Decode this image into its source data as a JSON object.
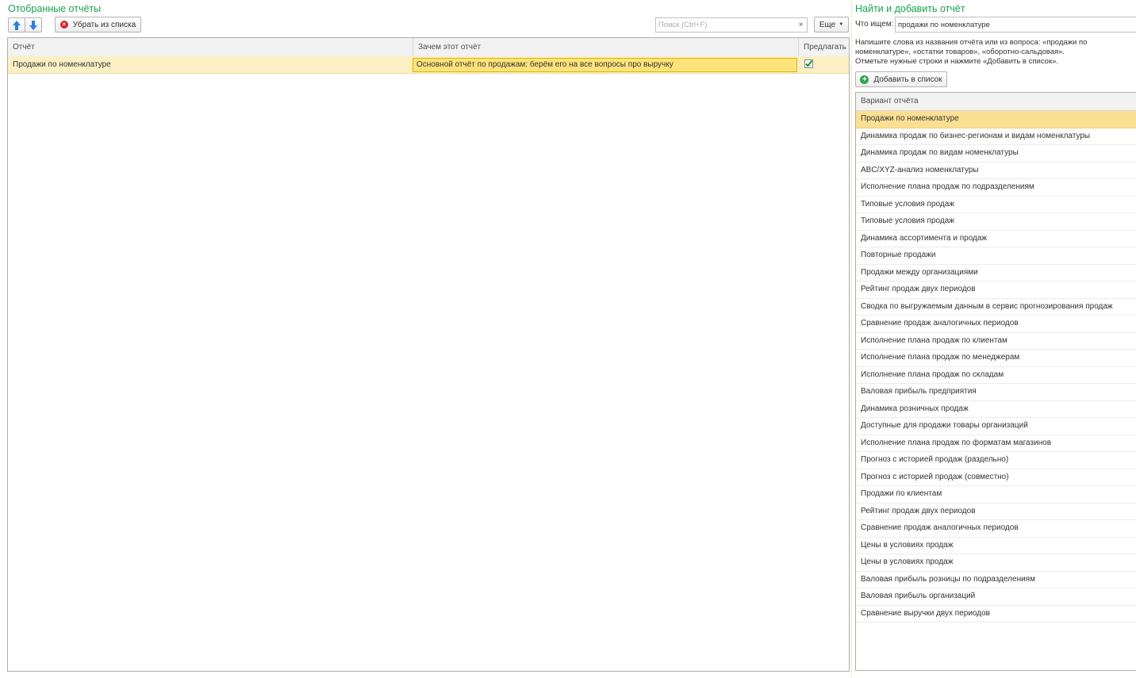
{
  "left": {
    "title": "Отобранные отчёты",
    "remove_label": "Убрать из списка",
    "search_placeholder": "Поиск (Ctrl+F)",
    "clear_label": "×",
    "more_label": "Еще",
    "columns": {
      "report": "Отчёт",
      "reason": "Зачем этот отчёт",
      "suggest": "Предлагать"
    },
    "rows": [
      {
        "report": "Продажи по номенклатуре",
        "reason": "Основной отчёт по продажам: берём его на все вопросы про выручку",
        "suggest": true
      }
    ]
  },
  "right": {
    "title": "Найти и добавить отчёт",
    "search_label": "Что ищем:",
    "search_value": "продажи по номенклатуре",
    "hint_lines": [
      "Напишите слова из названия отчёта или из вопроса: «продажи по",
      "номенклатуре», «остатки товаров», «оборотно-сальдовая».",
      "Отметьте нужные строки и нажмите «Добавить в список»."
    ],
    "add_label": "Добавить в список",
    "list_header": "Вариант отчёта",
    "items": [
      "Продажи по номенклатуре",
      "Динамика продаж по бизнес-регионам и видам номенклатуры",
      "Динамика продаж по видам номенклатуры",
      "ABC/XYZ-анализ номенклатуры",
      "Исполнение плана продаж по подразделениям",
      "Типовые условия продаж",
      "Типовые условия продаж",
      "Динамика ассортимента и продаж",
      "Повторные продажи",
      "Продажи между организациями",
      "Рейтинг продаж двух периодов",
      "Сводка по выгружаемым данным в сервис прогнозирования продаж",
      "Сравнение продаж аналогичных периодов",
      "Исполнение плана продаж по клиентам",
      "Исполнение плана продаж по менеджерам",
      "Исполнение плана продаж по складам",
      "Валовая прибыль предприятия",
      "Динамика розничных продаж",
      "Доступные для продажи товары организаций",
      "Исполнение плана продаж по форматам магазинов",
      "Прогноз с историей продаж (раздельно)",
      "Прогноз с историей продаж (совместно)",
      "Продажи по клиентам",
      "Рейтинг продаж двух периодов",
      "Сравнение продаж аналогичных периодов",
      "Цены в условиях продаж",
      "Цены в условиях продаж",
      "Валовая прибыль розницы по подразделениям",
      "Валовая прибыль организаций",
      "Сравнение выручки двух периодов"
    ],
    "selected_index": 0
  },
  "colors": {
    "accent_green": "#1aa34a",
    "selection": "#fbe093",
    "edit_cell": "#fce37c"
  }
}
